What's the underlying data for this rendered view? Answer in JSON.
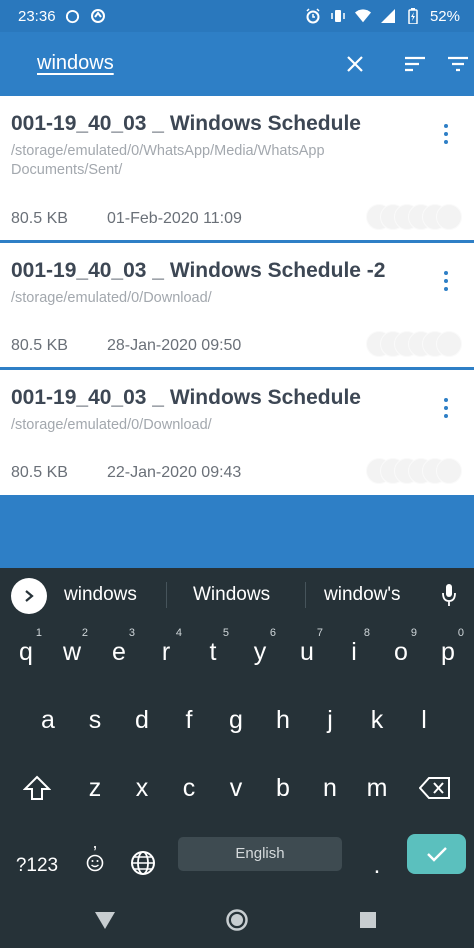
{
  "status_bar": {
    "time": "23:36",
    "battery": "52%"
  },
  "search": {
    "query": "windows"
  },
  "results": [
    {
      "title": "001-19_40_03 _  Windows Schedule",
      "path": "/storage/emulated/0/WhatsApp/Media/WhatsApp Documents/Sent/",
      "size": "80.5 KB",
      "date": "01-Feb-2020 11:09"
    },
    {
      "title": "001-19_40_03 _  Windows Schedule -2",
      "path": "/storage/emulated/0/Download/",
      "size": "80.5 KB",
      "date": "28-Jan-2020 09:50"
    },
    {
      "title": "001-19_40_03 _  Windows Schedule",
      "path": "/storage/emulated/0/Download/",
      "size": "80.5 KB",
      "date": "22-Jan-2020 09:43"
    }
  ],
  "keyboard": {
    "suggestions": [
      "windows",
      "Windows",
      "window's"
    ],
    "row1": [
      {
        "key": "q",
        "num": "1"
      },
      {
        "key": "w",
        "num": "2"
      },
      {
        "key": "e",
        "num": "3"
      },
      {
        "key": "r",
        "num": "4"
      },
      {
        "key": "t",
        "num": "5"
      },
      {
        "key": "y",
        "num": "6"
      },
      {
        "key": "u",
        "num": "7"
      },
      {
        "key": "i",
        "num": "8"
      },
      {
        "key": "o",
        "num": "9"
      },
      {
        "key": "p",
        "num": "0"
      }
    ],
    "row2": [
      "a",
      "s",
      "d",
      "f",
      "g",
      "h",
      "j",
      "k",
      "l"
    ],
    "row3": [
      "z",
      "x",
      "c",
      "v",
      "b",
      "n",
      "m"
    ],
    "symbols_label": "?123",
    "comma_label": ",",
    "space_label": "English",
    "period_label": "."
  },
  "colors": {
    "accent": "#2e7fc6",
    "keyboard_bg": "#263238",
    "enter_key": "#5bc0be"
  }
}
